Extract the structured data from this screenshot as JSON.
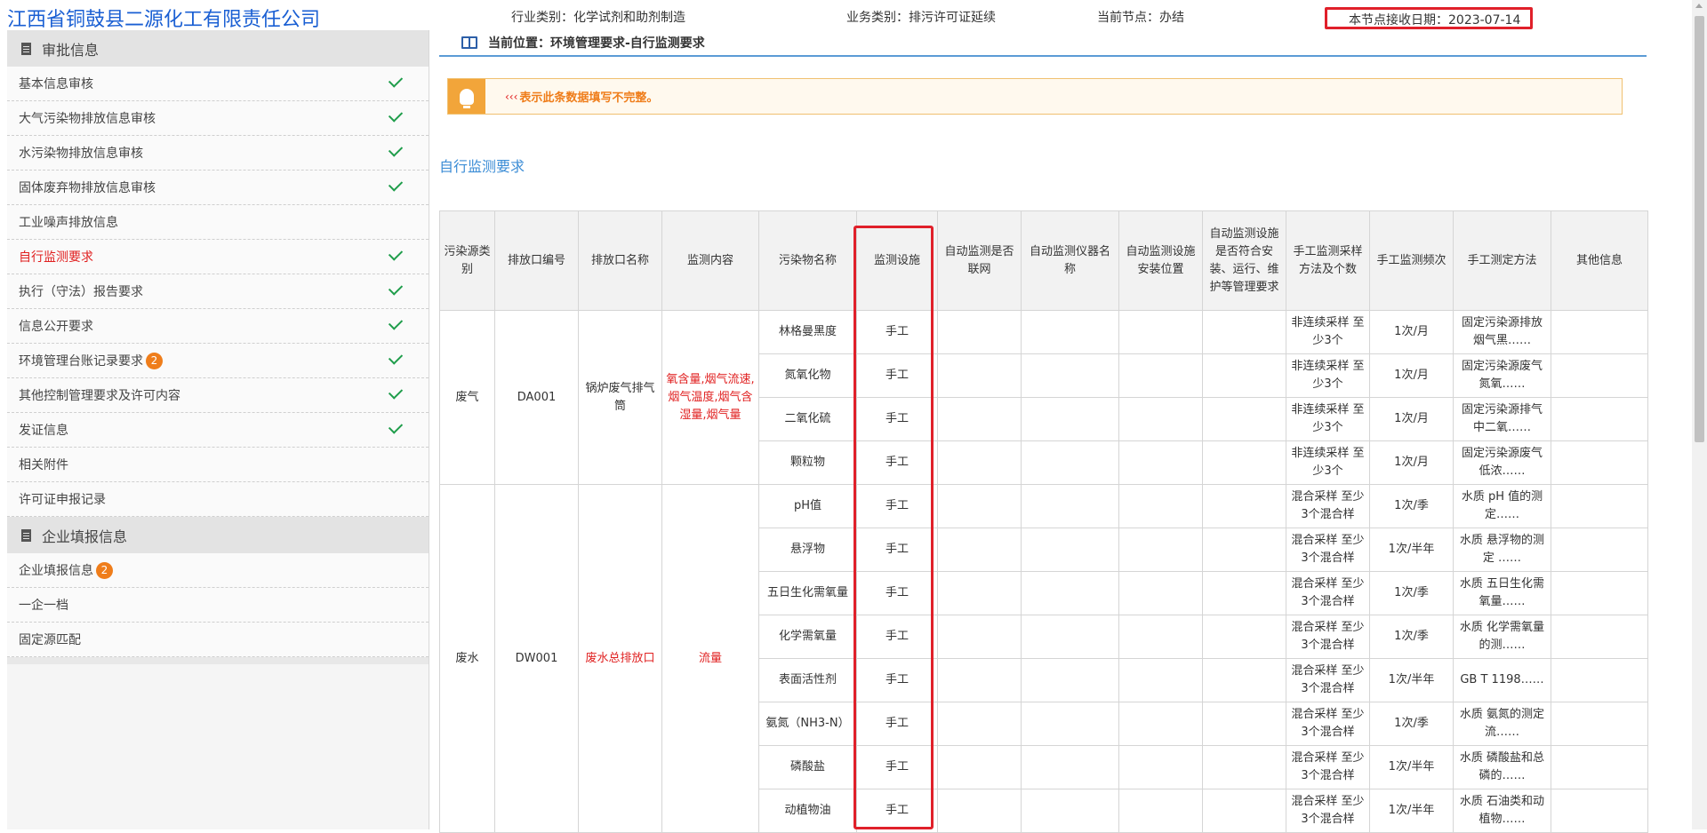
{
  "header": {
    "company": "江西省铜鼓县二源化工有限责任公司",
    "industry": "行业类别：化学试剂和助剂制造",
    "business": "业务类别：排污许可证延续",
    "node": "当前节点：办结",
    "received_date": "本节点接收日期：2023-07-14"
  },
  "sidebar": {
    "sections": [
      {
        "title": "审批信息",
        "items": [
          {
            "label": "基本信息审核",
            "checked": true
          },
          {
            "label": "大气污染物排放信息审核",
            "checked": true
          },
          {
            "label": "水污染物排放信息审核",
            "checked": true
          },
          {
            "label": "固体废弃物排放信息审核",
            "checked": true
          },
          {
            "label": "工业噪声排放信息",
            "checked": false
          },
          {
            "label": "自行监测要求",
            "checked": true,
            "active": true
          },
          {
            "label": "执行（守法）报告要求",
            "checked": true
          },
          {
            "label": "信息公开要求",
            "checked": true
          },
          {
            "label": "环境管理台账记录要求",
            "checked": true,
            "badge": "2"
          },
          {
            "label": "其他控制管理要求及许可内容",
            "checked": true
          },
          {
            "label": "发证信息",
            "checked": true
          },
          {
            "label": "相关附件",
            "checked": false
          },
          {
            "label": "许可证申报记录",
            "checked": false
          }
        ]
      },
      {
        "title": "企业填报信息",
        "items": [
          {
            "label": "企业填报信息",
            "checked": false,
            "badge": "2"
          },
          {
            "label": "一企一档",
            "checked": false
          },
          {
            "label": "固定源匹配",
            "checked": false
          }
        ]
      }
    ]
  },
  "main": {
    "breadcrumb": "当前位置：环境管理要求-自行监测要求",
    "notice_arrows": "‹‹‹",
    "notice": "表示此条数据填写不完整。",
    "section_title": "自行监测要求",
    "table": {
      "headers": [
        "污染源类别",
        "排放口编号",
        "排放口名称",
        "监测内容",
        "污染物名称",
        "监测设施",
        "自动监测是否联网",
        "自动监测仪器名称",
        "自动监测设施安装位置",
        "自动监测设施是否符合安装、运行、维护等管理要求",
        "手工监测采样方法及个数",
        "手工监测频次",
        "手工测定方法",
        "其他信息"
      ],
      "groups": [
        {
          "category": "废气",
          "outlet_code": "DA001",
          "outlet_name": "锅炉废气排气筒",
          "monitor_content": "氧含量,烟气流速,烟气温度,烟气含湿量,烟气量",
          "rows": [
            {
              "pollutant": "林格曼黑度",
              "facility": "手工",
              "sampling": "非连续采样 至少3个",
              "freq": "1次/月",
              "method": "固定污染源排放 烟气黑……"
            },
            {
              "pollutant": "氮氧化物",
              "facility": "手工",
              "sampling": "非连续采样 至少3个",
              "freq": "1次/月",
              "method": "固定污染源废气 氮氧……"
            },
            {
              "pollutant": "二氧化硫",
              "facility": "手工",
              "sampling": "非连续采样 至少3个",
              "freq": "1次/月",
              "method": "固定污染源排气 中二氧……"
            },
            {
              "pollutant": "颗粒物",
              "facility": "手工",
              "sampling": "非连续采样 至少3个",
              "freq": "1次/月",
              "method": "固定污染源废气 低浓……"
            }
          ]
        },
        {
          "category": "废水",
          "outlet_code": "DW001",
          "outlet_name": "废水总排放口",
          "monitor_content": "流量",
          "rows": [
            {
              "pollutant": "pH值",
              "facility": "手工",
              "sampling": "混合采样 至少3个混合样",
              "freq": "1次/季",
              "method": "水质 pH 值的测定……"
            },
            {
              "pollutant": "悬浮物",
              "facility": "手工",
              "sampling": "混合采样 至少3个混合样",
              "freq": "1次/半年",
              "method": "水质 悬浮物的测定 ……"
            },
            {
              "pollutant": "五日生化需氧量",
              "facility": "手工",
              "sampling": "混合采样 至少3个混合样",
              "freq": "1次/季",
              "method": "水质 五日生化需氧量……"
            },
            {
              "pollutant": "化学需氧量",
              "facility": "手工",
              "sampling": "混合采样 至少3个混合样",
              "freq": "1次/季",
              "method": "水质 化学需氧量的测……"
            },
            {
              "pollutant": "表面活性剂",
              "facility": "手工",
              "sampling": "混合采样 至少3个混合样",
              "freq": "1次/半年",
              "method": "GB T 1198……"
            },
            {
              "pollutant": "氨氮（NH3-N）",
              "facility": "手工",
              "sampling": "混合采样 至少3个混合样",
              "freq": "1次/季",
              "method": "水质 氨氮的测定 流……"
            },
            {
              "pollutant": "磷酸盐",
              "facility": "手工",
              "sampling": "混合采样 至少3个混合样",
              "freq": "1次/半年",
              "method": "水质 磷酸盐和总磷的……"
            },
            {
              "pollutant": "动植物油",
              "facility": "手工",
              "sampling": "混合采样 至少3个混合样",
              "freq": "1次/半年",
              "method": "水质 石油类和动植物……"
            }
          ]
        }
      ]
    }
  }
}
